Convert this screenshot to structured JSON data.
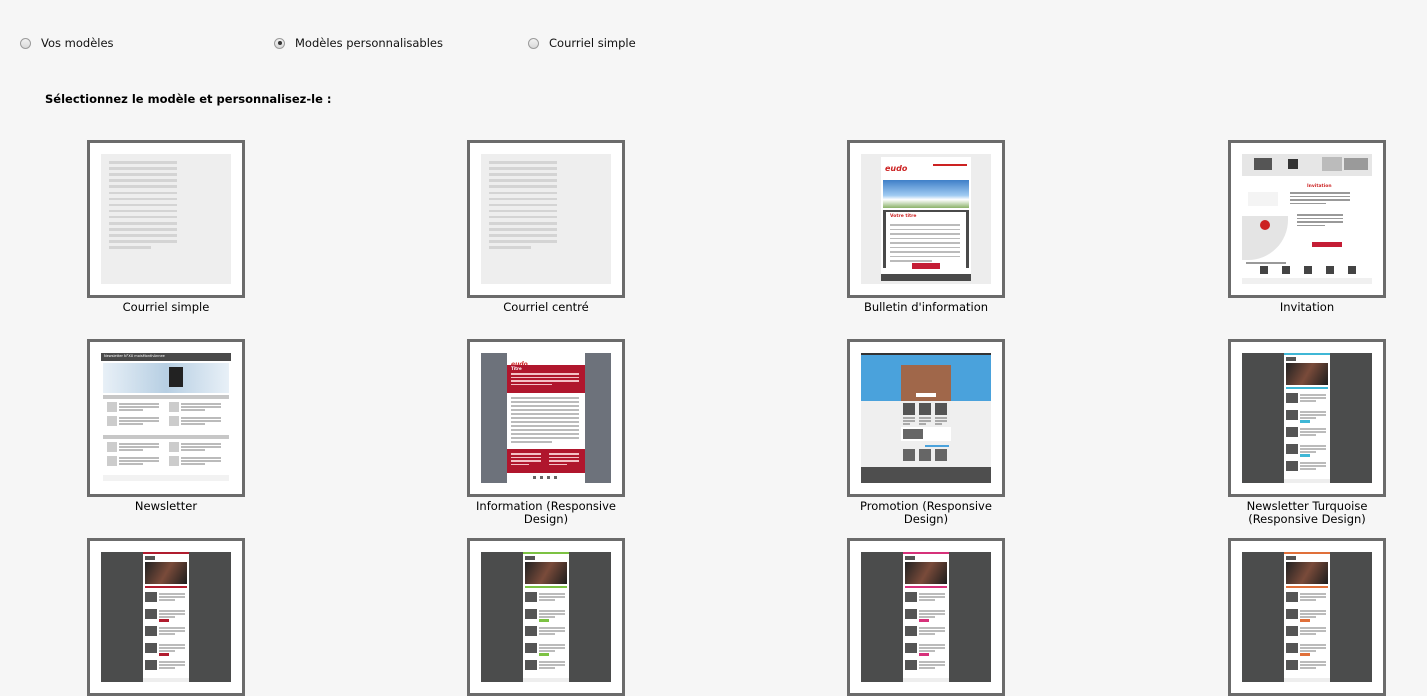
{
  "radio_options": [
    {
      "label": "Vos modèles",
      "checked": false
    },
    {
      "label": "Modèles personnalisables",
      "checked": true
    },
    {
      "label": "Courriel simple",
      "checked": false
    }
  ],
  "heading": "Sélectionnez le modèle et personnalisez-le :",
  "templates": [
    {
      "name": "Courriel simple",
      "line1": "Courriel simple",
      "line2": "",
      "thumb": "simple"
    },
    {
      "name": "Courriel centré",
      "line1": "Courriel centré",
      "line2": "",
      "thumb": "simple"
    },
    {
      "name": "Bulletin d'information",
      "line1": "Bulletin d'information",
      "line2": "",
      "thumb": "bulletin"
    },
    {
      "name": "Invitation",
      "line1": "Invitation",
      "line2": "",
      "thumb": "invitation"
    },
    {
      "name": "Newsletter",
      "line1": "Newsletter",
      "line2": "",
      "thumb": "newsletter"
    },
    {
      "name": "Information (Responsive Design)",
      "line1": "Information (Responsive",
      "line2": "Design)",
      "thumb": "information"
    },
    {
      "name": "Promotion (Responsive Design)",
      "line1": "Promotion (Responsive",
      "line2": "Design)",
      "thumb": "promotion"
    },
    {
      "name": "Newsletter Turquoise (Responsive Design)",
      "line1": "Newsletter Turquoise",
      "line2": "(Responsive Design)",
      "thumb": "dark",
      "accent": "#3fb7d6"
    },
    {
      "name": "",
      "line1": "",
      "line2": "",
      "thumb": "dark",
      "accent": "#b01c2e"
    },
    {
      "name": "",
      "line1": "",
      "line2": "",
      "thumb": "dark",
      "accent": "#7cc243"
    },
    {
      "name": "",
      "line1": "",
      "line2": "",
      "thumb": "dark",
      "accent": "#d6317a"
    },
    {
      "name": "",
      "line1": "",
      "line2": "",
      "thumb": "dark",
      "accent": "#e0703a"
    }
  ],
  "thumb_text": {
    "bulletin_title": "Votre titre",
    "bulletin_button": "Lire l'intégralité",
    "invitation_title": "Invitation",
    "invitation_button": "Inscription",
    "newsletter_header": "Newsletter N°XX moisMonthAnnee",
    "information_title": "Titre"
  }
}
